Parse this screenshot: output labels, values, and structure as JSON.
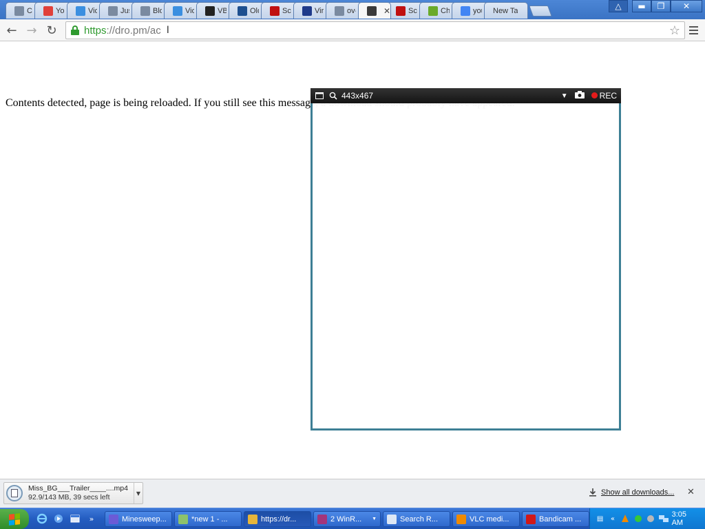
{
  "browser": {
    "tabs": [
      {
        "label": "Chr",
        "icon": "document-icon",
        "color": "#7a8aa0"
      },
      {
        "label": "You",
        "icon": "download-icon",
        "color": "#e0403a"
      },
      {
        "label": "Vid",
        "icon": "vimeo-check-icon",
        "color": "#3b8fe0"
      },
      {
        "label": "Jus",
        "icon": "document-icon",
        "color": "#7a8aa0"
      },
      {
        "label": "Bloc",
        "icon": "document-icon",
        "color": "#7a8aa0"
      },
      {
        "label": "Vid",
        "icon": "vimeo-check-icon",
        "color": "#3b8fe0"
      },
      {
        "label": "VB-",
        "icon": "vb-logo-icon",
        "color": "#222222"
      },
      {
        "label": "Old",
        "icon": "ov-logo-icon",
        "color": "#1d4f8f"
      },
      {
        "label": "Scr",
        "icon": "record-icon",
        "color": "#c01010"
      },
      {
        "label": "Virt",
        "icon": "virt-logo-icon",
        "color": "#1e3a8a"
      },
      {
        "label": "ov-",
        "icon": "document-icon",
        "color": "#7a8aa0"
      },
      {
        "label": "",
        "icon": "film-icon",
        "color": "#3a3a3a",
        "active": true
      },
      {
        "label": "Scr",
        "icon": "record-icon",
        "color": "#c01010"
      },
      {
        "label": "Cha",
        "icon": "music-note-icon",
        "color": "#6aaa2a"
      },
      {
        "label": "you",
        "icon": "google-icon",
        "color": "#4285f4"
      },
      {
        "label": "New Ta",
        "icon": "",
        "color": ""
      }
    ],
    "url_scheme": "https",
    "url_rest": "://dro.pm/ac"
  },
  "page": {
    "message": "Contents detected, page is being reloaded. If you still see this message, a download should probably have appeared."
  },
  "capture": {
    "size": "443x467",
    "rec_label": "REC"
  },
  "download": {
    "filename": "Miss_BG___Trailer____....mp4",
    "status": "92.9/143 MB, 39 secs left",
    "show_all": "Show all downloads..."
  },
  "taskbar": {
    "tasks": [
      {
        "label": "Minesweep...",
        "icon": "minesweeper-icon",
        "color": "#6b5bd6"
      },
      {
        "label": "*new 1 - ...",
        "icon": "notepad-icon",
        "color": "#8dc26b"
      },
      {
        "label": "https://dr...",
        "icon": "chrome-icon",
        "color": "#e6b53a",
        "active": true
      },
      {
        "label": "2 WinR...",
        "icon": "winrar-icon",
        "color": "#a3357b",
        "caret": true
      },
      {
        "label": "Search R...",
        "icon": "search-results-icon",
        "color": "#dde7f5"
      },
      {
        "label": "VLC medi...",
        "icon": "vlc-icon",
        "color": "#f08a00"
      },
      {
        "label": "Bandicam ...",
        "icon": "bandicam-icon",
        "color": "#d01818"
      }
    ],
    "clock": "3:05 AM"
  }
}
